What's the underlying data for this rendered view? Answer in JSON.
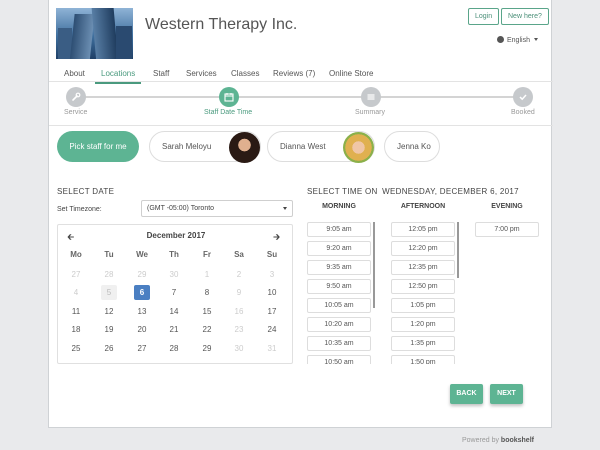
{
  "header": {
    "company": "Western Therapy Inc.",
    "login_label": "Login",
    "new_here_label": "New here?",
    "language": "English"
  },
  "tabs": [
    {
      "label": "About"
    },
    {
      "label": "Locations"
    },
    {
      "label": "Staff"
    },
    {
      "label": "Services"
    },
    {
      "label": "Classes"
    },
    {
      "label": "Reviews (7)"
    },
    {
      "label": "Online Store"
    }
  ],
  "active_tab": "Locations",
  "steps": [
    {
      "label": "Service",
      "icon": "wrench-icon"
    },
    {
      "label": "Staff Date Time",
      "icon": "calendar-icon"
    },
    {
      "label": "Summary",
      "icon": "list-icon"
    },
    {
      "label": "Booked",
      "icon": "check-icon"
    }
  ],
  "staff": {
    "pick_label": "Pick staff for me",
    "members": [
      {
        "name": "Sarah Meloyu"
      },
      {
        "name": "Dianna West"
      },
      {
        "name": "Jenna Ko"
      }
    ]
  },
  "date": {
    "section_title": "SELECT DATE",
    "timezone_label": "Set Timezone:",
    "timezone_value": "(GMT -05:00) Toronto",
    "month_label": "December 2017",
    "prev_icon": "arrow-left-icon",
    "next_icon": "arrow-right-icon",
    "weekdays": [
      "Mo",
      "Tu",
      "We",
      "Th",
      "Fr",
      "Sa",
      "Su"
    ],
    "weeks": [
      [
        "27",
        "28",
        "29",
        "30",
        "1",
        "2",
        "3"
      ],
      [
        "4",
        "5",
        "6",
        "7",
        "8",
        "9",
        "10"
      ],
      [
        "11",
        "12",
        "13",
        "14",
        "15",
        "16",
        "17"
      ],
      [
        "18",
        "19",
        "20",
        "21",
        "22",
        "23",
        "24"
      ],
      [
        "25",
        "26",
        "27",
        "28",
        "29",
        "30",
        "31"
      ]
    ],
    "selected_day": "6"
  },
  "time": {
    "section_title": "SELECT TIME ON",
    "selected_date": "WEDNESDAY, DECEMBER 6, 2017",
    "morning_label": "MORNING",
    "afternoon_label": "AFTERNOON",
    "evening_label": "EVENING",
    "morning": [
      "9:05 am",
      "9:20 am",
      "9:35 am",
      "9:50 am",
      "10:05 am",
      "10:20 am",
      "10:35 am",
      "10:50 am"
    ],
    "afternoon": [
      "12:05 pm",
      "12:20 pm",
      "12:35 pm",
      "12:50 pm",
      "1:05 pm",
      "1:20 pm",
      "1:35 pm",
      "1:50 pm"
    ],
    "evening": [
      "7:00 pm"
    ]
  },
  "nav": {
    "back_label": "BACK",
    "next_label": "NEXT"
  },
  "footer": {
    "powered_by": "Powered by",
    "brand": "bookshelf"
  },
  "colors": {
    "accent": "#5db493",
    "selected_day": "#4a7fc2"
  }
}
